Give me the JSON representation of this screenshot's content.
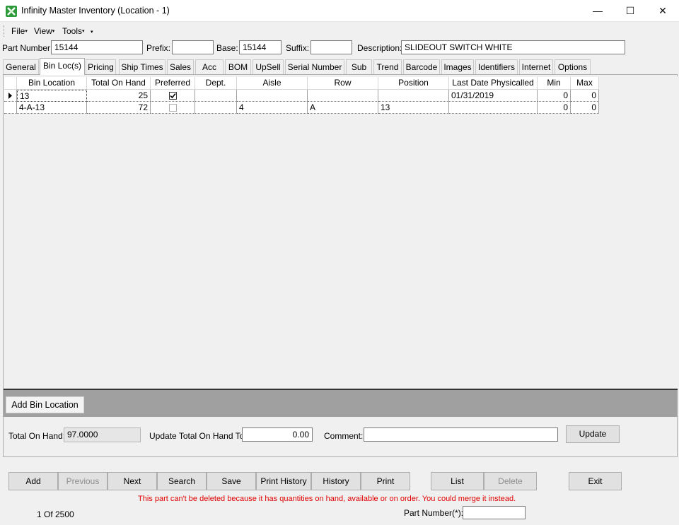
{
  "window": {
    "title": "Infinity Master Inventory (Location - 1)",
    "minimize": "—",
    "maximize": "☐",
    "close": "✕"
  },
  "menu": [
    {
      "label": "File",
      "dd": "▾"
    },
    {
      "label": "View",
      "dd": "▾"
    },
    {
      "label": "Tools",
      "dd": "▾"
    },
    {
      "label": "",
      "dd": "▾"
    }
  ],
  "fields": {
    "part_number_label": "Part Number:",
    "part_number": "15144",
    "prefix_label": "Prefix:",
    "prefix": "",
    "base_label": "Base:",
    "base": "15144",
    "suffix_label": "Suffix:",
    "suffix": "",
    "description_label": "Description:",
    "description": "SLIDEOUT SWITCH  WHITE"
  },
  "tabs": [
    "General",
    "Bin Loc(s)",
    "Pricing",
    "Ship Times",
    "Sales",
    "Acc",
    "BOM",
    "UpSell",
    "Serial Number",
    "Sub",
    "Trend",
    "Barcode",
    "Images",
    "Identifiers",
    "Internet",
    "Options"
  ],
  "active_tab": "Bin Loc(s)",
  "grid": {
    "columns": [
      "Bin Location",
      "Total On Hand",
      "Preferred",
      "Dept.",
      "Aisle",
      "Row",
      "Position",
      "Last Date Physicalled",
      "Min",
      "Max"
    ],
    "rows": [
      {
        "current": true,
        "bin": "13",
        "total": "25",
        "preferred": true,
        "dept": "",
        "aisle": "",
        "row": "",
        "position": "",
        "last": "01/31/2019",
        "min": "0",
        "max": "0"
      },
      {
        "current": false,
        "bin": "4-A-13",
        "total": "72",
        "preferred": false,
        "dept": "",
        "aisle": "4",
        "row": "A",
        "position": "13",
        "last": "",
        "min": "0",
        "max": "0"
      }
    ]
  },
  "add_bin_label": "Add Bin Location",
  "onhand": {
    "total_label": "Total On Hand:",
    "total_value": "97.0000",
    "update_label": "Update Total On Hand To:",
    "update_value": "0.00",
    "comment_label": "Comment:",
    "comment_value": "",
    "update_button": "Update"
  },
  "buttons": {
    "add": "Add",
    "previous": "Previous",
    "next": "Next",
    "search": "Search",
    "save": "Save",
    "print_history": "Print History",
    "history": "History",
    "print": "Print",
    "list": "List",
    "delete": "Delete",
    "exit": "Exit"
  },
  "message": "This part can't be deleted because it has quantities on hand, available or on order.  You could merge it instead.",
  "record_counter": "1  Of 2500",
  "lookup": {
    "label": "Part Number(*):",
    "value": ""
  },
  "colors": {
    "accent_icon": "#2e9b3a",
    "warning_text": "#e00000"
  }
}
